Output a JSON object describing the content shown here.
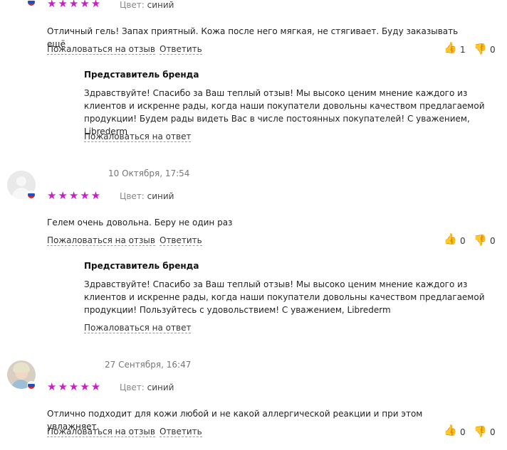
{
  "labels": {
    "color_label": "Цвет:",
    "report_review": "Пожаловаться на отзыв",
    "reply": "Ответить",
    "report_answer": "Пожаловаться на ответ",
    "brand_rep": "Представитель бренда"
  },
  "reviews": [
    {
      "date": "",
      "stars": "★★★★★",
      "rating": 5,
      "color_value": "синий",
      "text": "Отличный гель! Запах приятный. Кожа после него мягкая, не стягивает. Буду заказывать ещё",
      "likes": "1",
      "dislikes": "0",
      "brand_reply": "Здравствуйте! Спасибо за Ваш теплый отзыв! Мы высоко ценим мнение каждого из клиентов и искренне рады, когда наши покупатели довольны качеством предлагаемой продукции! Будем рады видеть Вас в числе постоянных покупателей! С уважением, Librederm"
    },
    {
      "date": "10 Октября, 17:54",
      "stars": "★★★★★",
      "rating": 5,
      "color_value": "синий",
      "text": "Гелем очень довольна. Беру не один раз",
      "likes": "0",
      "dislikes": "0",
      "brand_reply": "Здравствуйте! Спасибо за Ваш теплый отзыв! Мы высоко ценим мнение каждого из клиентов и искренне рады, когда наши покупатели довольны качеством предлагаемой продукции! Пользуйтесь с удовольствием! С уважением, Librederm"
    },
    {
      "date": "27 Сентября, 16:47",
      "stars": "★★★★★",
      "rating": 5,
      "color_value": "синий",
      "text": "Отлично подходит для кожи любой и не какой аллергической реакции и при этом увлажняет.",
      "likes": "0",
      "dislikes": "0"
    }
  ],
  "icons": {
    "like": "thumbs-up-icon",
    "dislike": "thumbs-down-icon",
    "flag": "russia-flag-icon"
  },
  "colors": {
    "star": "#c81ec8",
    "icon": "#cfcfcf"
  }
}
